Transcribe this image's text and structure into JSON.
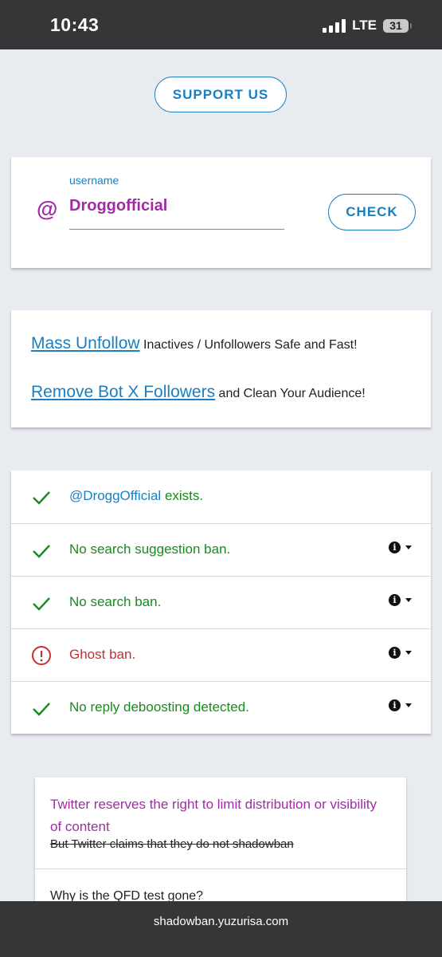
{
  "status_bar": {
    "time": "10:43",
    "network": "LTE",
    "battery": "31"
  },
  "support_button": "SUPPORT US",
  "username_form": {
    "at_symbol": "@",
    "label": "username",
    "value": "Droggofficial",
    "check_button": "CHECK"
  },
  "promos": [
    {
      "link": "Mass Unfollow",
      "text": " Inactives / Unfollowers Safe and Fast!"
    },
    {
      "link": "Remove Bot X Followers",
      "text": " and Clean Your Audience!"
    }
  ],
  "results": {
    "exists_handle": "@DroggOfficial",
    "exists_suffix": " exists.",
    "rows": [
      {
        "status": "ok",
        "text": "No search suggestion ban."
      },
      {
        "status": "ok",
        "text": "No search ban."
      },
      {
        "status": "warning",
        "text": "Ghost ban."
      },
      {
        "status": "ok",
        "text": "No reply deboosting detected."
      }
    ]
  },
  "info": {
    "statement": "Twitter reserves the right to limit distribution or visibility of content",
    "struck_claim": "But Twitter claims that they do not shadowban",
    "question": "Why is the QFD test gone?"
  },
  "url_bar": "shadowban.yuzurisa.com",
  "colors": {
    "accent_blue": "#1a7fc1",
    "purple": "#a12ba7",
    "ok_green": "#188a1e",
    "warning_red": "#c62f2f"
  }
}
